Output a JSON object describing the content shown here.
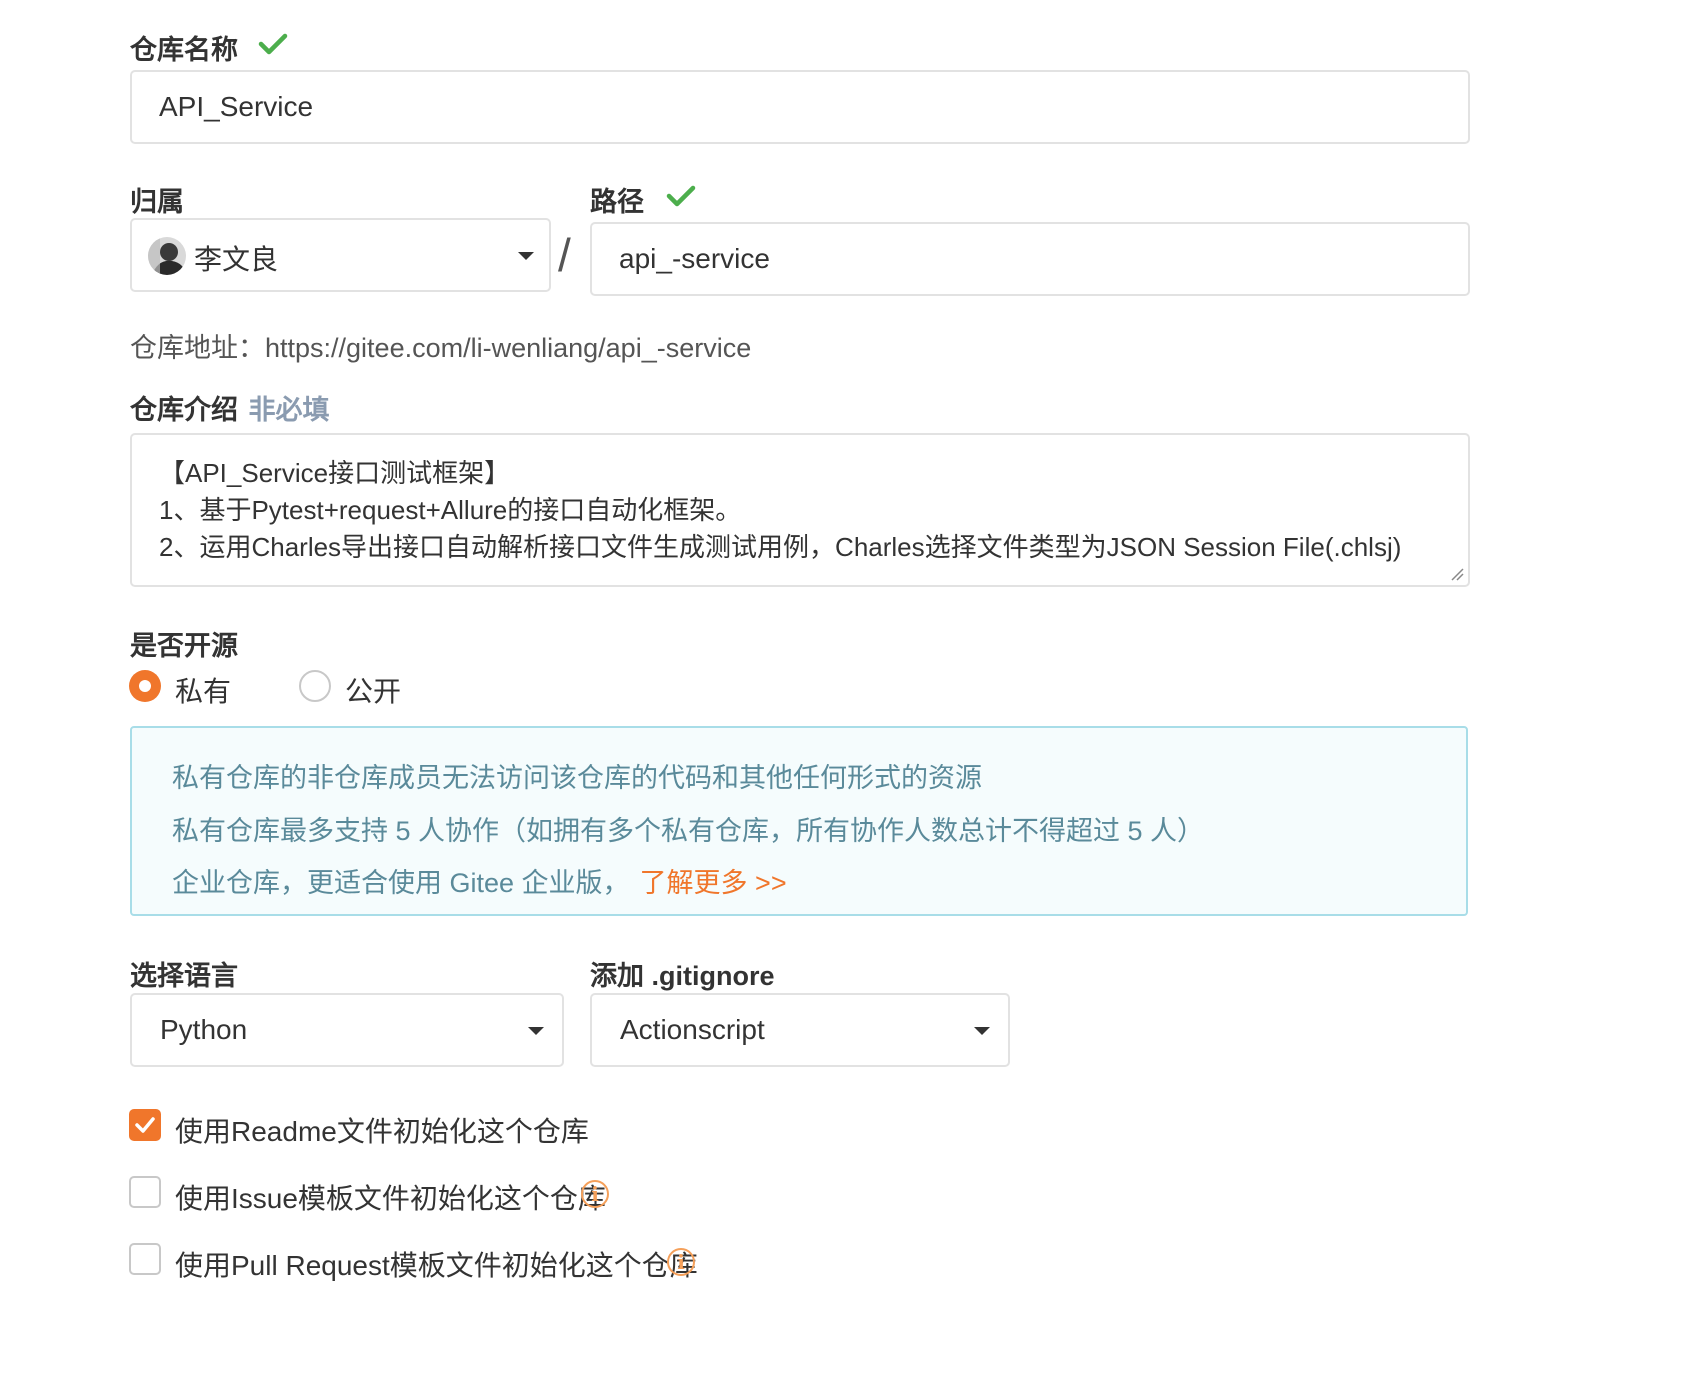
{
  "repo_name": {
    "label": "仓库名称",
    "value": "API_Service"
  },
  "owner": {
    "label": "归属",
    "value": "李文良",
    "separator": "/"
  },
  "path": {
    "label": "路径",
    "value": "api_-service"
  },
  "repo_url": {
    "prefix": "仓库地址：",
    "url": "https://gitee.com/li-wenliang/api_-service"
  },
  "description": {
    "label": "仓库介绍",
    "optional": "非必填",
    "lines": [
      "【API_Service接口测试框架】",
      "1、基于Pytest+request+Allure的接口自动化框架。",
      "2、运用Charles导出接口自动解析接口文件生成测试用例，Charles选择文件类型为JSON Session File(.chlsj)"
    ]
  },
  "visibility": {
    "label": "是否开源",
    "options": [
      "私有",
      "公开"
    ],
    "selected": "私有"
  },
  "private_notice": {
    "line1": "私有仓库的非仓库成员无法访问该仓库的代码和其他任何形式的资源",
    "line2": "私有仓库最多支持 5 人协作（如拥有多个私有仓库，所有协作人数总计不得超过 5 人）",
    "line3_prefix": "企业仓库，更适合使用 Gitee 企业版，",
    "learn_more": "了解更多 >>"
  },
  "language": {
    "label": "选择语言",
    "value": "Python"
  },
  "gitignore": {
    "label": "添加 .gitignore",
    "value": "Actionscript"
  },
  "init_options": [
    {
      "label": "使用Readme文件初始化这个仓库",
      "checked": true
    },
    {
      "label": "使用Issue模板文件初始化这个仓库",
      "checked": false
    },
    {
      "label": "使用Pull Request模板文件初始化这个仓库",
      "checked": false
    }
  ],
  "colors": {
    "accent": "#f0762b",
    "success": "#4cae4c",
    "notice_bg": "#f5fcfd",
    "notice_border": "#a8dde8",
    "notice_text": "#5a8a9a"
  }
}
